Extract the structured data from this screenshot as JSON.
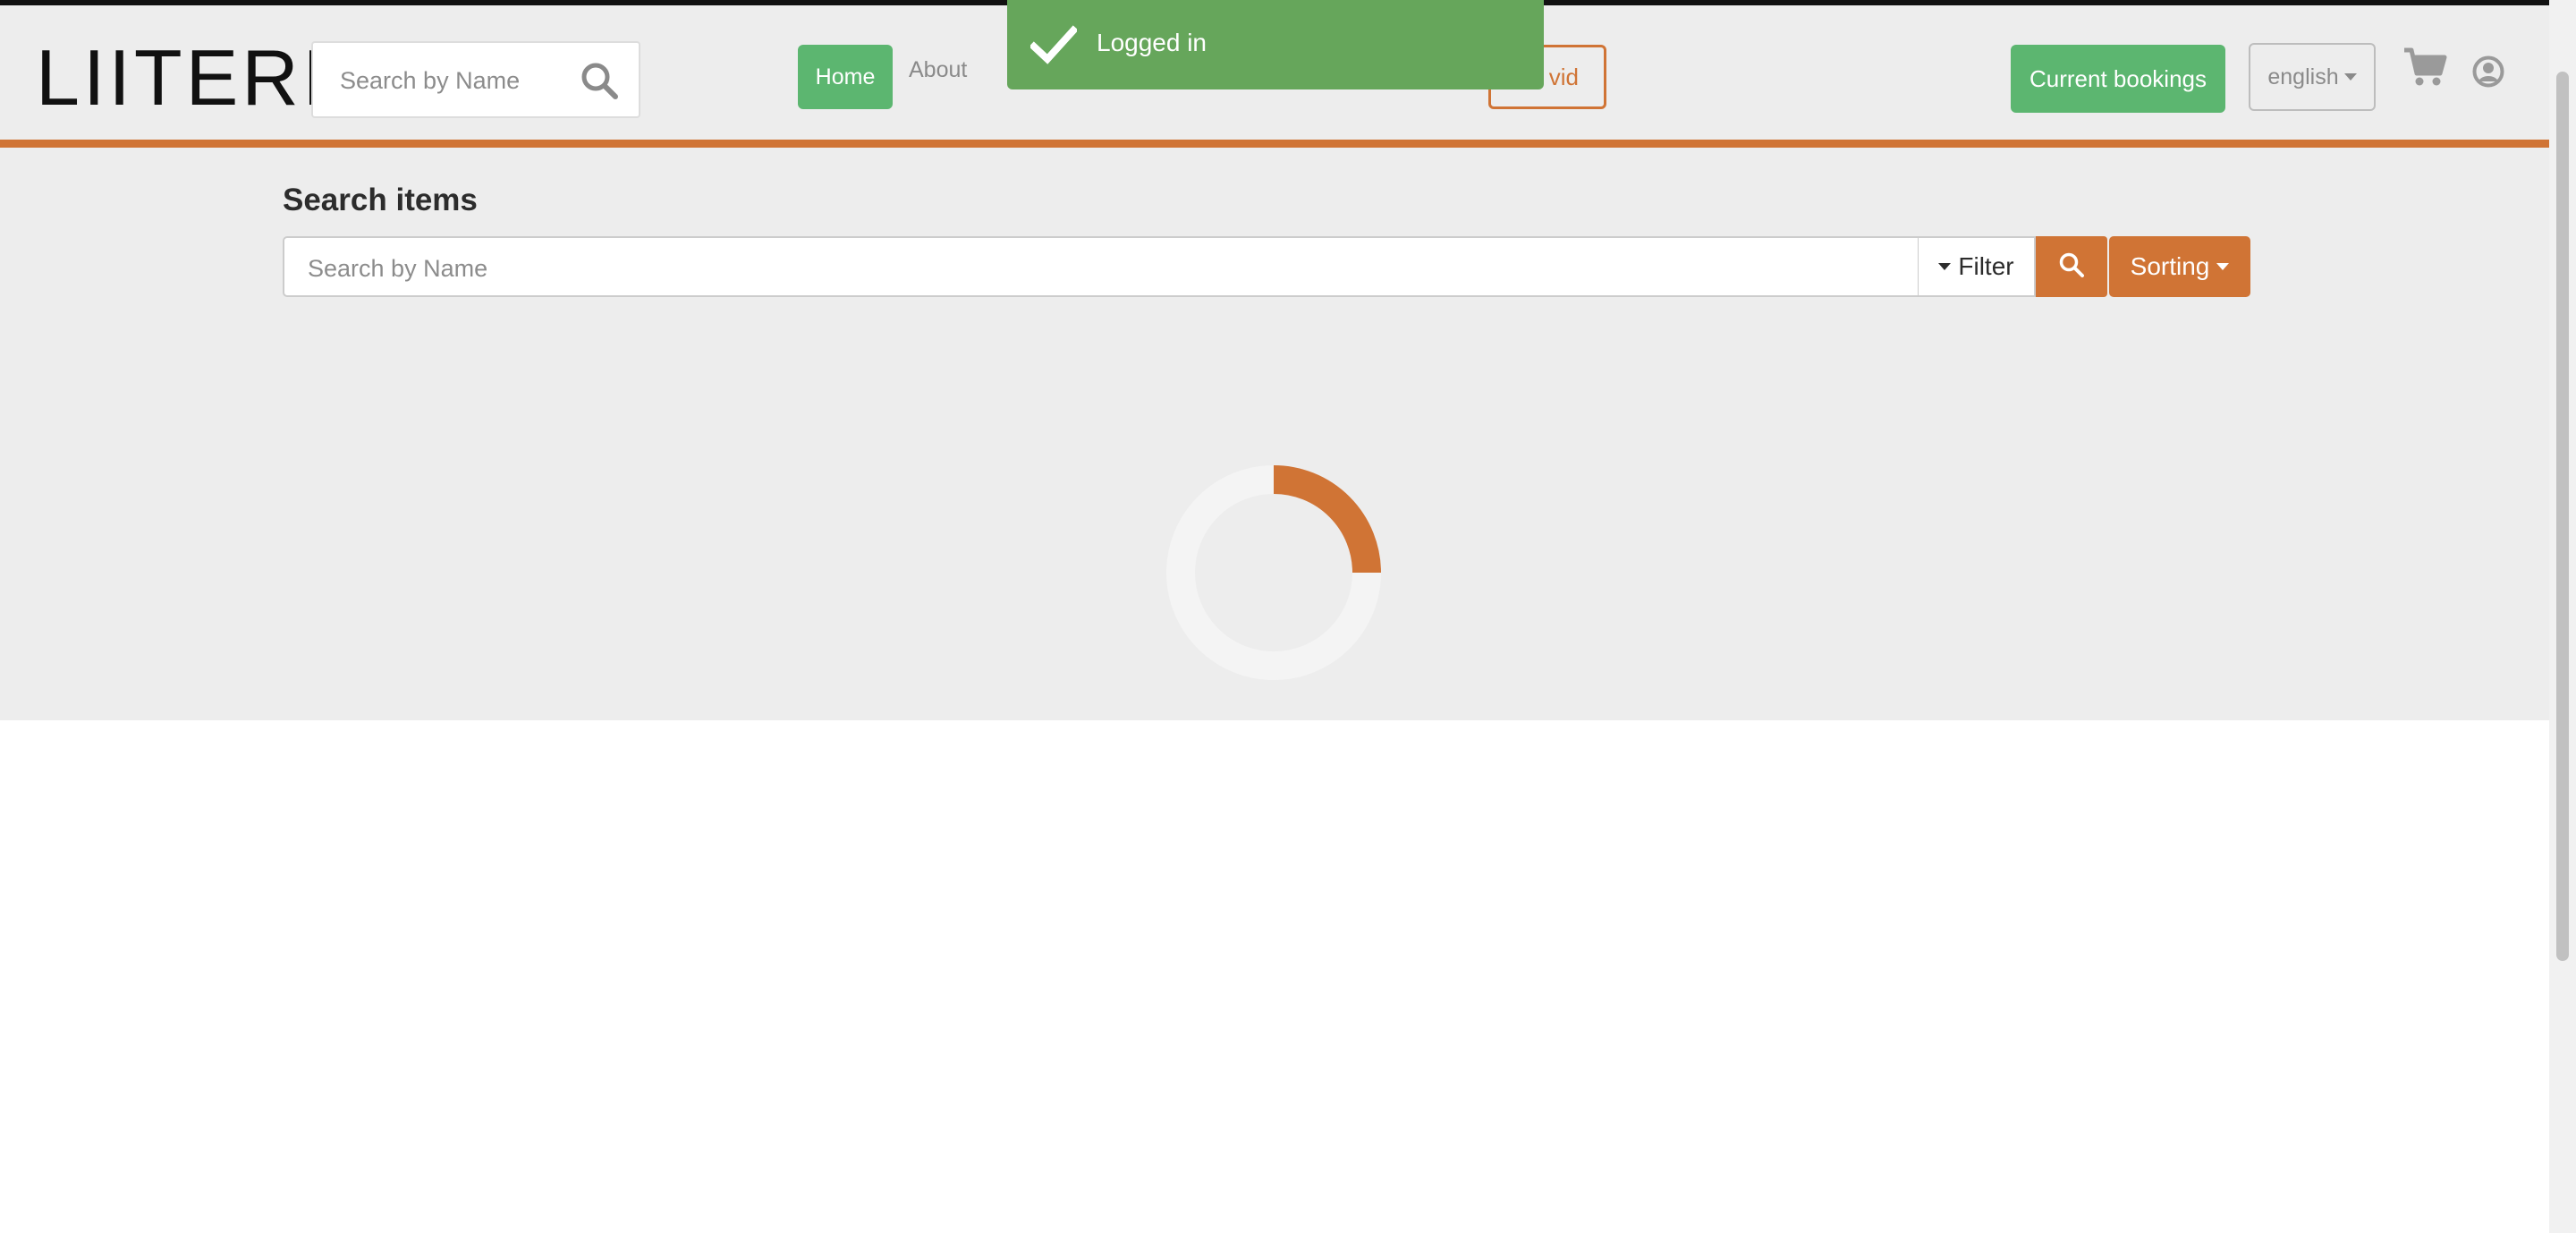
{
  "brand": {
    "logo_text": "LIITERI"
  },
  "header": {
    "search_placeholder": "Search by Name",
    "nav": {
      "home_label": "Home",
      "about_label": "About"
    },
    "user_button_label": "vid",
    "bookings_label": "Current bookings",
    "language": "english",
    "icons": {
      "search": "search-icon",
      "cart": "cart-icon",
      "user": "user-circle-icon"
    }
  },
  "toast": {
    "message": "Logged in",
    "icon": "check-icon",
    "color": "#66a65b"
  },
  "main": {
    "title": "Search items",
    "search_placeholder": "Search by Name",
    "filter_label": "Filter",
    "sorting_label": "Sorting",
    "loading_progress": 0.25
  },
  "colors": {
    "accent": "#d07435",
    "success": "#5cb670",
    "background": "#ededed"
  }
}
